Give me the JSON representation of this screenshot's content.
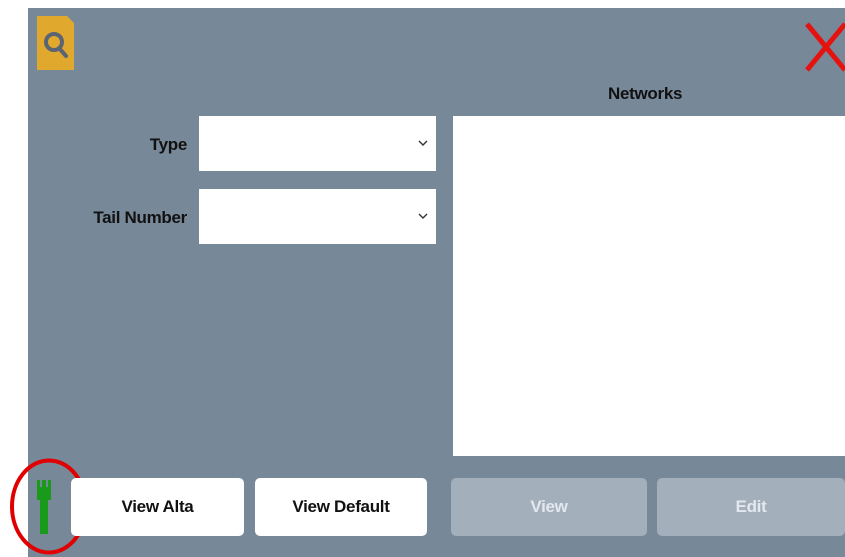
{
  "header": {
    "app_icon": "search-document-icon",
    "close_icon": "close-x-icon",
    "close_color": "#e5130f"
  },
  "form": {
    "type_label": "Type",
    "type_value": "",
    "tail_number_label": "Tail Number",
    "tail_number_value": ""
  },
  "networks": {
    "label": "Networks",
    "items": []
  },
  "buttons": {
    "view_alta": "View Alta",
    "view_default": "View Default",
    "view": "View",
    "edit": "Edit"
  },
  "status": {
    "connection_icon": "ethernet-plug-icon",
    "connection_color": "#1a9a1a",
    "highlight_color": "#e00000"
  },
  "colors": {
    "panel_bg": "#778899",
    "app_icon_bg": "#e0a92e",
    "disabled_button_bg": "#a3afbb"
  }
}
